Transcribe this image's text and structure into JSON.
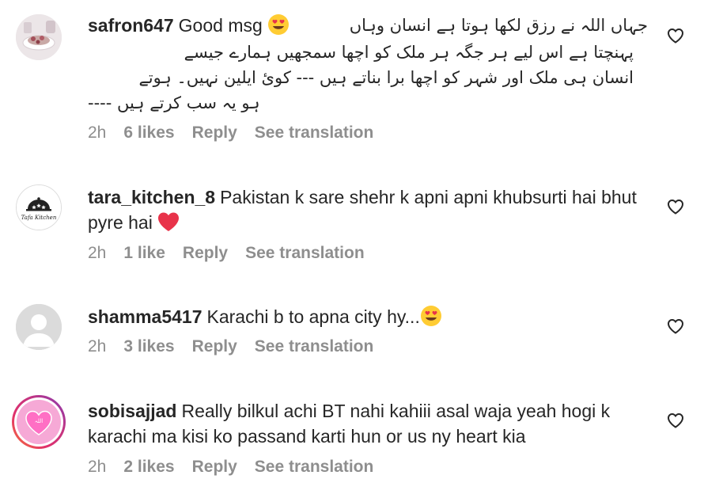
{
  "comments": [
    {
      "username": "safron647",
      "text_first": "Good msg",
      "emoji": "smiling-face-with-heart-eyes",
      "urdu_lines": [
        "جہاں اللہ نے رزق لکھا ہوتا ہے انسان وہاں",
        "پہنچتا ہے اس لیے ہر جگہ ہر ملک کو اچھا سمجھیں ہمارے جیسے",
        "انسان ہی ملک اور شہر کو اچھا برا بناتے ہیں --- کوئ ایلین نہیں۔ ہوتے",
        "ہو یہ سب کرتے ہیں ----"
      ],
      "time": "2h",
      "likes": "6 likes",
      "reply": "Reply",
      "see_translation": "See translation"
    },
    {
      "username": "tara_kitchen_8",
      "text": "Pakistan k sare shehr k apni apni khubsurti hai bhut pyre hai",
      "emoji": "red-heart",
      "avatar_caption": "Tafa Kitchen",
      "time": "2h",
      "likes": "1 like",
      "reply": "Reply",
      "see_translation": "See translation"
    },
    {
      "username": "shamma5417",
      "text": "Karachi b to apna city hy...",
      "emoji": "smiling-face-with-heart-eyes",
      "time": "2h",
      "likes": "3 likes",
      "reply": "Reply",
      "see_translation": "See translation"
    },
    {
      "username": "sobisajjad",
      "text": "Really bilkul achi BT nahi kahiii asal waja yeah hogi k karachi ma kisi ko passand karti hun or us ny heart kia",
      "avatar_caption": "اللہ",
      "time": "2h",
      "likes": "2 likes",
      "reply": "Reply",
      "see_translation": "See translation"
    }
  ],
  "colors": {
    "text": "#262626",
    "meta": "#8e8e8e",
    "story_ring_start": "#c13584",
    "story_ring_end": "#f77737"
  },
  "icons": {
    "like": "heart-outline-icon"
  }
}
